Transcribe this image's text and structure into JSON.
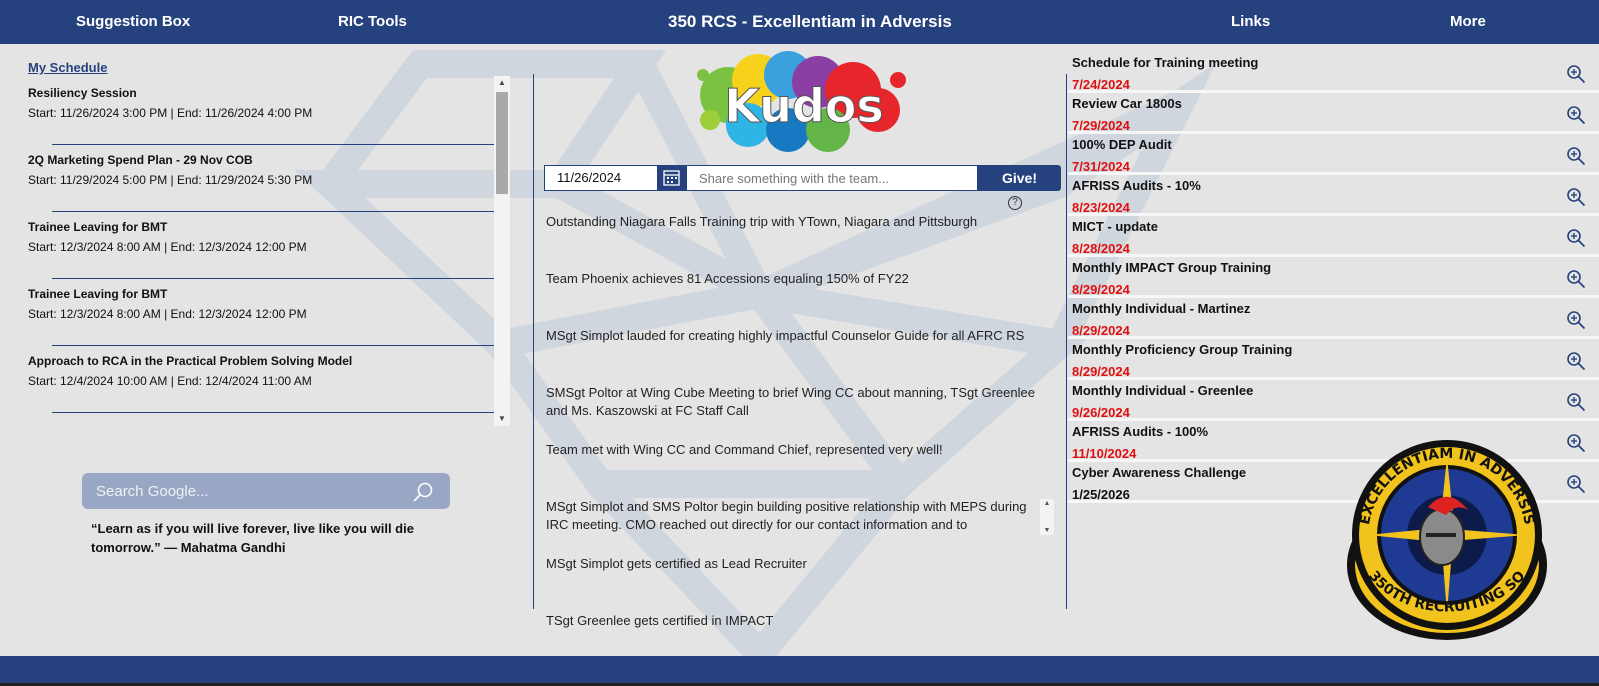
{
  "header": {
    "nav_left": [
      "Suggestion Box",
      "RIC Tools"
    ],
    "title": "350 RCS - Excellentiam in Adversis",
    "nav_right": [
      "Links",
      "More"
    ]
  },
  "schedule": {
    "title": "My Schedule",
    "items": [
      {
        "name": "Resiliency Session",
        "time": "Start: 11/26/2024 3:00 PM | End: 11/26/2024 4:00 PM"
      },
      {
        "name": "2Q Marketing Spend Plan - 29 Nov COB",
        "time": "Start: 11/29/2024 5:00 PM | End: 11/29/2024 5:30 PM"
      },
      {
        "name": "Trainee Leaving for BMT",
        "time": "Start: 12/3/2024 8:00 AM | End: 12/3/2024 12:00 PM"
      },
      {
        "name": "Trainee Leaving for BMT",
        "time": "Start: 12/3/2024 8:00 AM | End: 12/3/2024 12:00 PM"
      },
      {
        "name": "Approach to RCA in the Practical Problem Solving Model",
        "time": "Start: 12/4/2024 10:00 AM | End: 12/4/2024 11:00 AM"
      }
    ]
  },
  "search": {
    "placeholder": "Search Google..."
  },
  "quote": "“Learn as if you will live forever, live like you will die tomorrow.” — Mahatma Gandhi",
  "kudos": {
    "logo_text": "Kudos",
    "date_value": "11/26/2024",
    "share_placeholder": "Share something with the team...",
    "give_label": "Give!",
    "help_glyph": "?",
    "items": [
      "Outstanding Niagara Falls Training trip with YTown, Niagara and Pittsburgh",
      "Team Phoenix achieves 81 Accessions equaling 150% of FY22",
      "MSgt Simplot lauded for creating highly impactful Counselor Guide for all AFRC RS",
      "SMSgt Poltor at Wing Cube Meeting to brief Wing CC about manning, TSgt Greenlee and Ms. Kaszowski at FC Staff Call",
      "Team met with Wing CC and Command Chief, represented very well!",
      "MSgt Simplot and SMS Poltor begin building positive relationship with MEPS during IRC meeting. CMO reached out directly for our contact information and to",
      "MSgt Simplot gets certified as Lead Recruiter",
      "TSgt Greenlee gets certified in IMPACT"
    ]
  },
  "events": [
    {
      "name": "Schedule for Training meeting",
      "date": "7/24/2024"
    },
    {
      "name": "Review Car 1800s",
      "date": "7/29/2024"
    },
    {
      "name": "100% DEP Audit",
      "date": "7/31/2024"
    },
    {
      "name": "AFRISS Audits - 10%",
      "date": "8/23/2024"
    },
    {
      "name": "MICT - update",
      "date": "8/28/2024"
    },
    {
      "name": "Monthly IMPACT Group Training",
      "date": "8/29/2024"
    },
    {
      "name": "Monthly Individual - Martinez",
      "date": "8/29/2024"
    },
    {
      "name": "Monthly Proficiency Group Training",
      "date": "8/29/2024"
    },
    {
      "name": "Monthly Individual - Greenlee",
      "date": "9/26/2024"
    },
    {
      "name": "AFRISS Audits - 100%",
      "date": "11/10/2024"
    },
    {
      "name": "Cyber Awareness Challenge",
      "date": "1/25/2026"
    }
  ],
  "badge": {
    "top_text": "EXCELLENTIAM IN ADVERSIS",
    "bottom_text": "350TH RECRUITING SQ"
  },
  "colors": {
    "brand": "#26427e",
    "date_red": "#e01010",
    "background": "#e4e4e4"
  }
}
